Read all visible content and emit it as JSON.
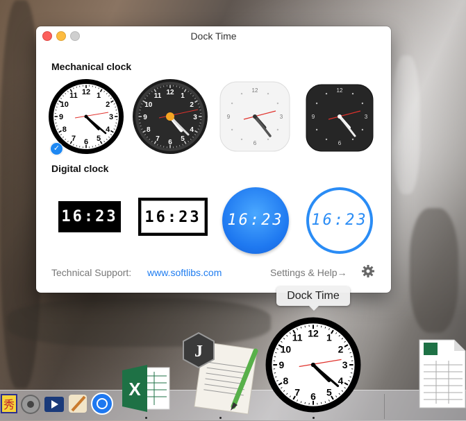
{
  "window": {
    "title": "Dock Time",
    "sections": {
      "mechanical": "Mechanical clock",
      "digital": "Digital clock"
    },
    "clock_numbers": [
      "12",
      "1",
      "2",
      "3",
      "4",
      "5",
      "6",
      "7",
      "8",
      "9",
      "10",
      "11"
    ],
    "minimal_numbers": [
      "12",
      "3",
      "6",
      "9"
    ],
    "digital_time": "16:23",
    "selected_style": "mechanical-1",
    "footer": {
      "support_label": "Technical Support:",
      "support_link": "www.softlibs.com",
      "settings_label": "Settings & Help→"
    },
    "colors": {
      "accent": "#1e88f2",
      "second_hand": "#e0312b"
    }
  },
  "dock": {
    "tooltip": "Dock Time",
    "clock_numbers": [
      "12",
      "1",
      "2",
      "3",
      "4",
      "5",
      "6",
      "7",
      "8",
      "9",
      "10",
      "11"
    ],
    "excel_letter": "X",
    "scripteditor_letter": "J"
  }
}
